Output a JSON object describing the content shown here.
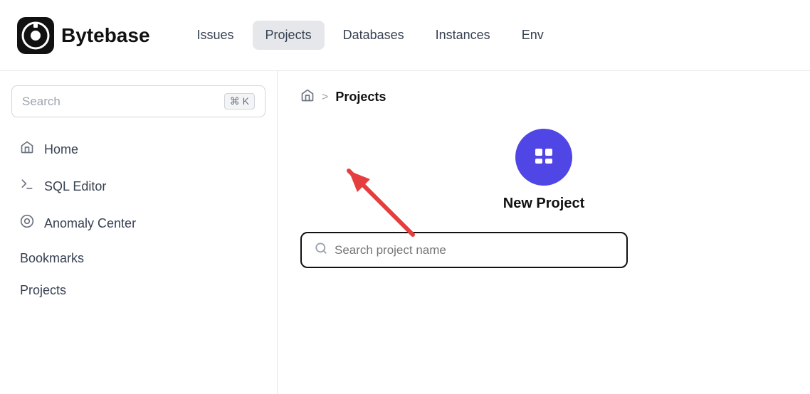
{
  "logo": {
    "text": "Bytebase"
  },
  "nav": {
    "items": [
      {
        "label": "Issues",
        "active": false
      },
      {
        "label": "Projects",
        "active": true
      },
      {
        "label": "Databases",
        "active": false
      },
      {
        "label": "Instances",
        "active": false
      },
      {
        "label": "Env",
        "active": false
      }
    ]
  },
  "sidebar": {
    "search": {
      "placeholder": "Search",
      "kbd": "⌘ K"
    },
    "items": [
      {
        "label": "Home",
        "icon": "🏠"
      },
      {
        "label": "SQL Editor",
        "icon": "▶"
      },
      {
        "label": "Anomaly Center",
        "icon": "🛡"
      }
    ],
    "sections": [
      {
        "label": "Bookmarks"
      },
      {
        "label": "Projects"
      }
    ]
  },
  "content": {
    "breadcrumb": {
      "home_icon": "🏠",
      "separator": ">",
      "current": "Projects"
    },
    "new_project": {
      "label": "New Project"
    },
    "search": {
      "placeholder": "Search project name",
      "icon": "🔍"
    }
  }
}
